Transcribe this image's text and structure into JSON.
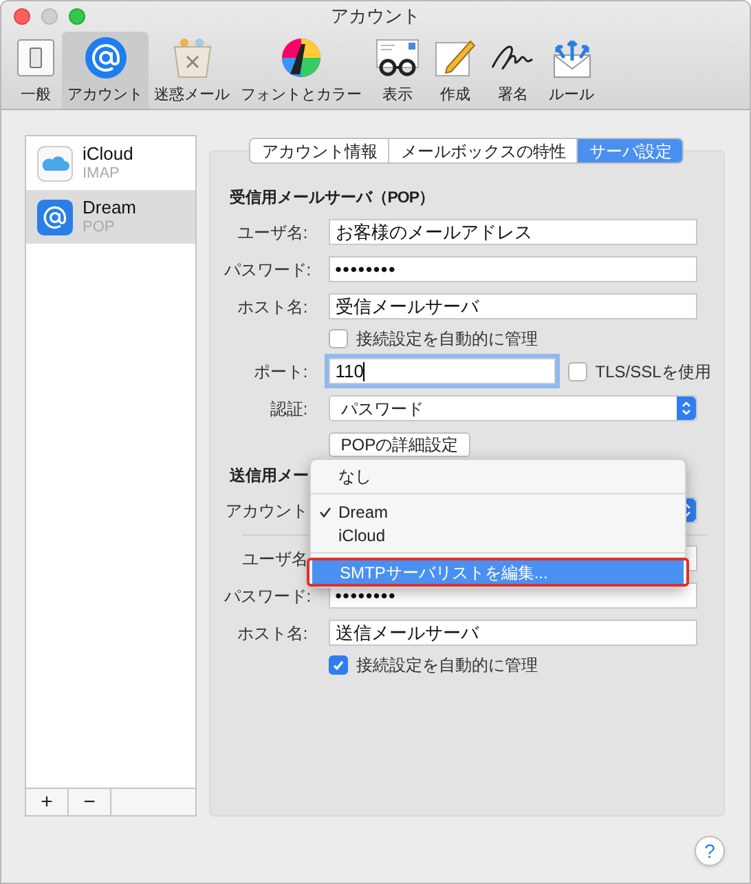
{
  "window": {
    "title": "アカウント"
  },
  "toolbar": [
    {
      "label": "一般",
      "kind": "switch",
      "selected": false
    },
    {
      "label": "アカウント",
      "kind": "at",
      "selected": true
    },
    {
      "label": "迷惑メール",
      "kind": "trash",
      "selected": false
    },
    {
      "label": "フォントとカラー",
      "kind": "font",
      "selected": false
    },
    {
      "label": "表示",
      "kind": "glasses",
      "selected": false
    },
    {
      "label": "作成",
      "kind": "pencil",
      "selected": false
    },
    {
      "label": "署名",
      "kind": "signature",
      "selected": false
    },
    {
      "label": "ルール",
      "kind": "rules",
      "selected": false
    }
  ],
  "accounts": [
    {
      "name": "iCloud",
      "type": "IMAP",
      "kind": "cloud",
      "selected": false
    },
    {
      "name": "Dream",
      "type": "POP",
      "kind": "at",
      "selected": true
    }
  ],
  "list_buttons": [
    "+",
    "−"
  ],
  "tabs": [
    {
      "label": "アカウント情報",
      "selected": false
    },
    {
      "label": "メールボックスの特性",
      "selected": false
    },
    {
      "label": "サーバ設定",
      "selected": true
    }
  ],
  "incoming": {
    "heading": "受信用メールサーバ（POP）",
    "rows": [
      {
        "kind": "text",
        "label": "ユーザ名:",
        "value": "お客様のメールアドレス"
      },
      {
        "kind": "password",
        "label": "パスワード:",
        "value": "••••••••"
      },
      {
        "kind": "text",
        "label": "ホスト名:",
        "value": "受信メールサーバ"
      },
      {
        "kind": "checkbox",
        "label": "接続設定を自動的に管理",
        "checked": false
      },
      {
        "kind": "port",
        "label": "ポート:",
        "value": "110",
        "focused": true,
        "option": {
          "label": "TLS/SSLを使用",
          "checked": false
        }
      },
      {
        "kind": "select",
        "label": "認証:",
        "value": "パスワード"
      },
      {
        "kind": "button",
        "label": "POPの詳細設定"
      }
    ]
  },
  "outgoing": {
    "heading": "送信用メー",
    "rows": [
      {
        "kind": "select",
        "label": "アカウント"
      },
      {
        "kind": "divider"
      },
      {
        "kind": "text",
        "label": "ユーザ名"
      },
      {
        "kind": "password",
        "label": "パスワード:",
        "value": "••••••••"
      },
      {
        "kind": "text",
        "label": "ホスト名:",
        "value": "送信メールサーバ"
      },
      {
        "kind": "checkbox",
        "label": "接続設定を自動的に管理",
        "checked": true
      }
    ]
  },
  "menu": {
    "items": [
      {
        "kind": "item",
        "label": "なし",
        "checked": false,
        "selected": false,
        "highlighted": false
      },
      {
        "kind": "separator"
      },
      {
        "kind": "item",
        "label": "Dream",
        "checked": true,
        "selected": false,
        "highlighted": false
      },
      {
        "kind": "item",
        "label": "iCloud",
        "checked": false,
        "selected": false,
        "highlighted": false
      },
      {
        "kind": "separator"
      },
      {
        "kind": "item",
        "label": "SMTPサーバリストを編集...",
        "checked": false,
        "selected": true,
        "highlighted": true
      }
    ]
  },
  "help": "?"
}
